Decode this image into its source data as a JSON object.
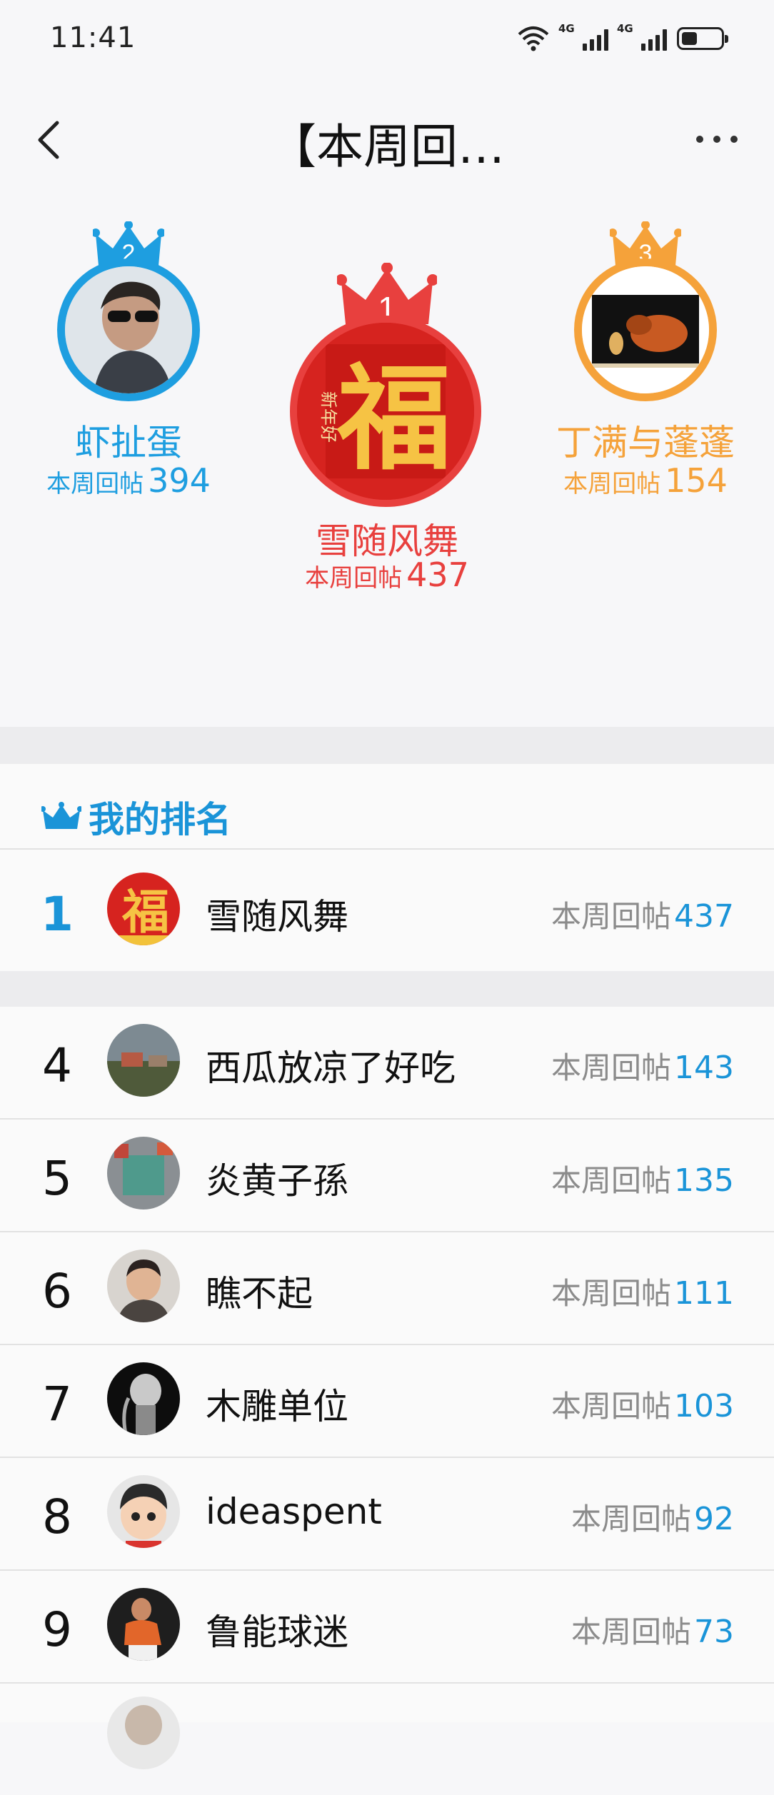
{
  "status_bar": {
    "time": "11:41",
    "network_1": "4G",
    "network_2": "4G",
    "battery_level": 0.4
  },
  "header": {
    "title": "【本周回…",
    "back_icon": "chevron-left-icon",
    "more_icon": "more-dots-icon"
  },
  "podium": {
    "first": {
      "rank": "1",
      "name": "雪随风舞",
      "label": "本周回帖",
      "count": "437",
      "color": "#e8403e",
      "avatar_text": "福",
      "avatar_small": "新年好"
    },
    "second": {
      "rank": "2",
      "name": "虾扯蛋",
      "label": "本周回帖",
      "count": "394",
      "color": "#1e9ee0"
    },
    "third": {
      "rank": "3",
      "name": "丁满与蓬蓬",
      "label": "本周回帖",
      "count": "154",
      "color": "#f5a23a"
    }
  },
  "my_rank": {
    "title": "我的排名",
    "rank": "1",
    "name": "雪随风舞",
    "label": "本周回帖",
    "count": "437"
  },
  "list": [
    {
      "rank": "4",
      "name": "西瓜放凉了好吃",
      "label": "本周回帖",
      "count": "143"
    },
    {
      "rank": "5",
      "name": "炎黄子孫",
      "label": "本周回帖",
      "count": "135"
    },
    {
      "rank": "6",
      "name": "瞧不起",
      "label": "本周回帖",
      "count": "111"
    },
    {
      "rank": "7",
      "name": "木雕单位",
      "label": "本周回帖",
      "count": "103"
    },
    {
      "rank": "8",
      "name": "ideaspent",
      "label": "本周回帖",
      "count": "92"
    },
    {
      "rank": "9",
      "name": "鲁能球迷",
      "label": "本周回帖",
      "count": "73"
    }
  ],
  "colors": {
    "accent": "#1a94d8",
    "gold": "#f5a23a",
    "red": "#e8403e"
  }
}
